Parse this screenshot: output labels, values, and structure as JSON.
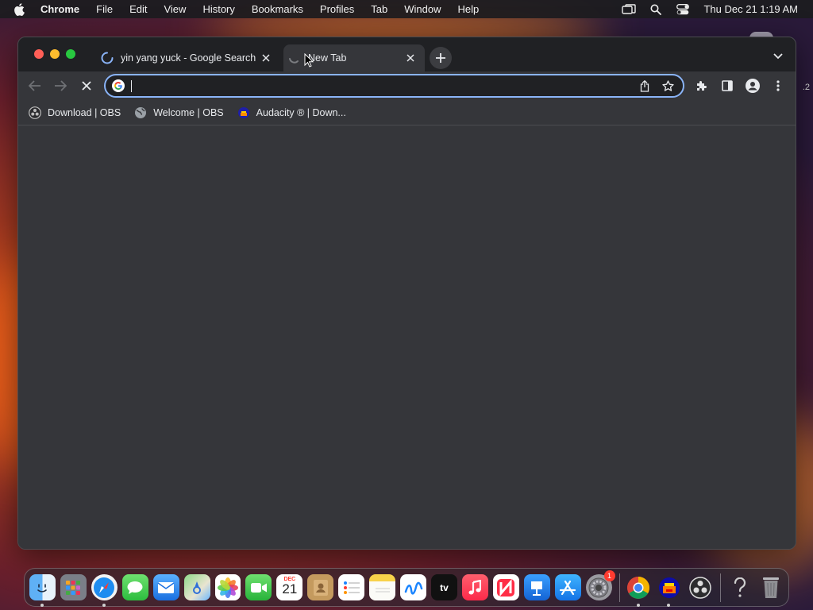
{
  "menubar": {
    "app_name": "Chrome",
    "items": [
      "File",
      "Edit",
      "View",
      "History",
      "Bookmarks",
      "Profiles",
      "Tab",
      "Window",
      "Help"
    ],
    "clock": "Thu Dec 21  1:19 AM"
  },
  "tabs": [
    {
      "title": "yin yang yuck - Google Search",
      "state": "loading"
    },
    {
      "title": "New Tab",
      "state": "active"
    }
  ],
  "omnibox": {
    "value": "",
    "placeholder": ""
  },
  "bookmarks": [
    {
      "label": "Download | OBS",
      "icon": "obs-icon"
    },
    {
      "label": "Welcome | OBS",
      "icon": "globe-icon"
    },
    {
      "label": "Audacity ® | Down...",
      "icon": "audacity-icon"
    }
  ],
  "side_number": ".2",
  "dock": {
    "apps": [
      {
        "name": "Finder",
        "icon": "finder-icon",
        "running": true
      },
      {
        "name": "Launchpad",
        "icon": "launchpad-icon",
        "running": false
      },
      {
        "name": "Safari",
        "icon": "safari-icon",
        "running": true
      },
      {
        "name": "Messages",
        "icon": "messages-icon",
        "running": false
      },
      {
        "name": "Mail",
        "icon": "mail-icon",
        "running": false
      },
      {
        "name": "Maps",
        "icon": "maps-icon",
        "running": false
      },
      {
        "name": "Photos",
        "icon": "photos-icon",
        "running": false
      },
      {
        "name": "FaceTime",
        "icon": "facetime-icon",
        "running": false
      },
      {
        "name": "Calendar",
        "icon": "calendar-icon",
        "running": false,
        "month": "DEC",
        "day": "21"
      },
      {
        "name": "Contacts",
        "icon": "contacts-icon",
        "running": false
      },
      {
        "name": "Reminders",
        "icon": "reminders-icon",
        "running": false
      },
      {
        "name": "Notes",
        "icon": "notes-icon",
        "running": false
      },
      {
        "name": "Freeform",
        "icon": "freeform-icon",
        "running": false
      },
      {
        "name": "TV",
        "icon": "tv-icon",
        "running": false,
        "label": "tv"
      },
      {
        "name": "Music",
        "icon": "music-icon",
        "running": false
      },
      {
        "name": "News",
        "icon": "news-icon",
        "running": false
      },
      {
        "name": "Keynote",
        "icon": "keynote-icon",
        "running": false
      },
      {
        "name": "App Store",
        "icon": "appstore-icon",
        "running": false
      },
      {
        "name": "System Settings",
        "icon": "settings-icon",
        "running": false,
        "badge": "1"
      }
    ],
    "running_apps": [
      {
        "name": "Chrome",
        "icon": "chrome-icon",
        "running": true
      },
      {
        "name": "Audacity",
        "icon": "audacity-icon",
        "running": true
      },
      {
        "name": "OBS",
        "icon": "obs-icon",
        "running": false
      }
    ],
    "utilities": [
      {
        "name": "Help",
        "icon": "help-icon"
      },
      {
        "name": "Trash",
        "icon": "trash-icon"
      }
    ]
  }
}
